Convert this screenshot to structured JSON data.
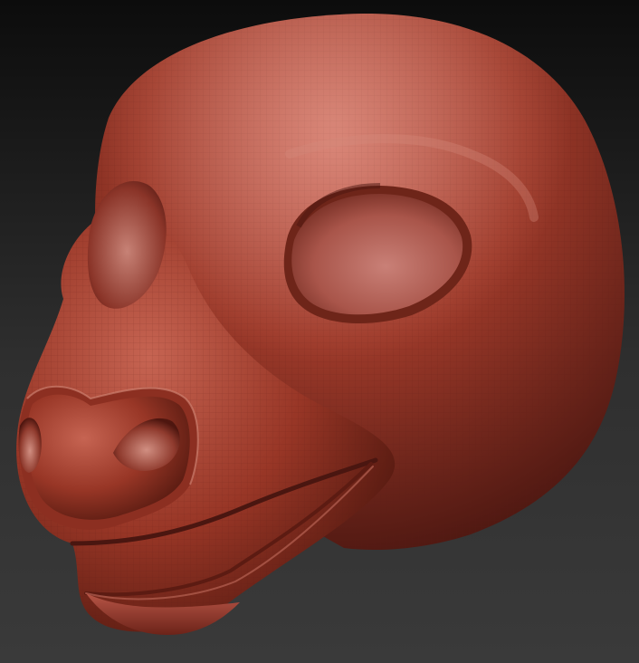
{
  "scene": {
    "subject": "sculpted-animal-head",
    "colors": {
      "background_top": "#0c0c0c",
      "background_bottom": "#3a3a3a",
      "clay_base": "#9e3a2a",
      "clay_highlight": "#d88a78",
      "clay_shadow": "#4a1610",
      "eye_socket": "#b3685c",
      "wire_line": "#6a2218"
    }
  }
}
